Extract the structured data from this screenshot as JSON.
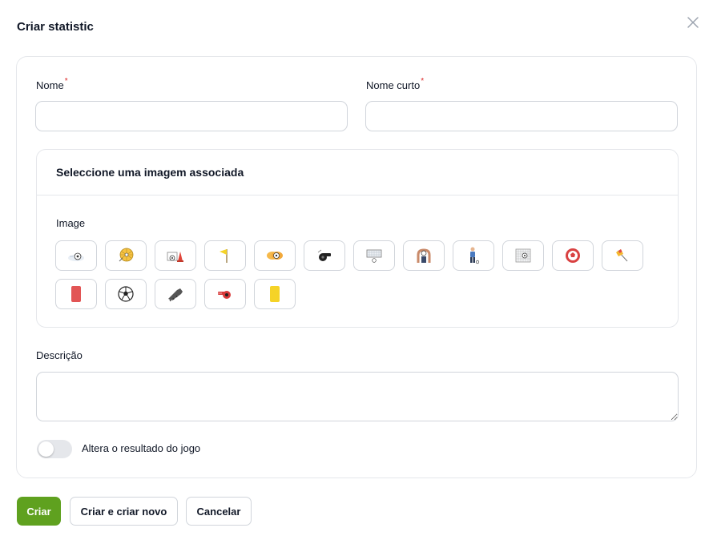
{
  "modal": {
    "title": "Criar statistic"
  },
  "fields": {
    "nome": {
      "label": "Nome",
      "required_mark": "*",
      "value": ""
    },
    "nome_curto": {
      "label": "Nome curto",
      "required_mark": "*",
      "value": ""
    },
    "descricao": {
      "label": "Descrição",
      "value": ""
    }
  },
  "image_section": {
    "title": "Seleccione uma imagem associada",
    "label": "Image",
    "options": [
      "ball-on-ground-icon",
      "ball-in-net-icon",
      "ball-and-cone-icon",
      "corner-flag-icon",
      "gloves-catch-ball-icon",
      "whistle-icon",
      "goal-and-ball-icon",
      "goalkeeper-save-icon",
      "player-kick-icon",
      "net-ball-icon",
      "soccer-ball-red-icon",
      "linesman-flag-icon",
      "red-card-icon",
      "soccer-ball-icon",
      "football-boot-icon",
      "red-whistle-icon",
      "yellow-card-icon"
    ]
  },
  "toggle": {
    "label": "Altera o resultado do jogo",
    "checked": false
  },
  "actions": {
    "create": "Criar",
    "create_and_new": "Criar e criar novo",
    "cancel": "Cancelar"
  },
  "colors": {
    "primary": "#5fa11f",
    "required": "#dc2626",
    "border": "#d1d5db",
    "red_card": "#e25555",
    "yellow_card": "#f5d327"
  }
}
